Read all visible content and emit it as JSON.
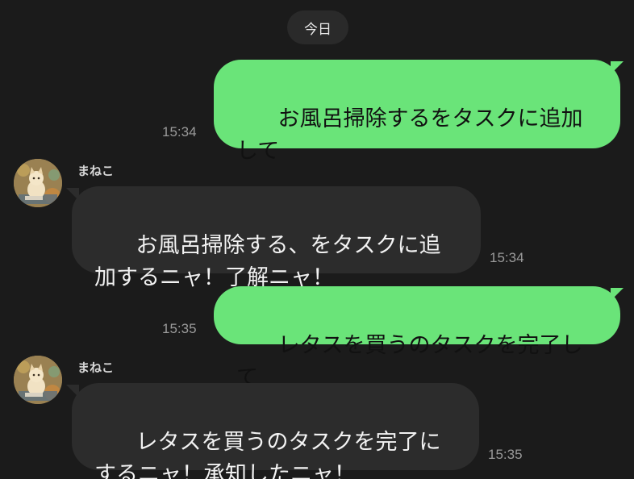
{
  "date_divider": {
    "label": "今日"
  },
  "messages": [
    {
      "direction": "out",
      "text": "お風呂掃除するをタスクに追加して",
      "time": "15:34"
    },
    {
      "direction": "in",
      "sender": "まねこ",
      "text": "お風呂掃除する、をタスクに追加するニャ！了解ニャ！",
      "time": "15:34"
    },
    {
      "direction": "out",
      "text": "レタスを買うのタスクを完了して",
      "time": "15:35"
    },
    {
      "direction": "in",
      "sender": "まねこ",
      "text": "レタスを買うのタスクを完了にするニャ！承知したニャ！",
      "time": "15:35"
    }
  ],
  "colors": {
    "background": "#1b1b1b",
    "outgoing_bubble": "#6ae479",
    "incoming_bubble": "#2c2c2c",
    "date_pill": "#2a2a2a",
    "timestamp": "#9a9a9a"
  },
  "icons": {
    "avatar": "cat-avatar-icon"
  }
}
